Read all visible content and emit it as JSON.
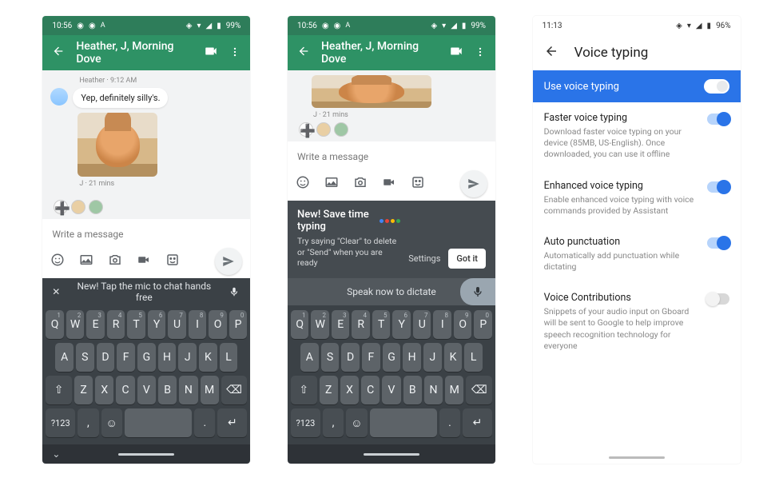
{
  "phones": {
    "p1": {
      "status": {
        "time": "10:56",
        "battery": "99%"
      },
      "title": "Heather, J, Morning Dove",
      "chat": {
        "meta1": "Heather · 9:12 AM",
        "bubble": "Yep, definitely silly's.",
        "meta2": "J · 21 mins"
      },
      "compose_placeholder": "Write a message",
      "strip_text": "New! Tap the mic to chat hands free",
      "kb": {
        "row1": [
          "Q",
          "W",
          "E",
          "R",
          "T",
          "Y",
          "U",
          "I",
          "O",
          "P"
        ],
        "row1sup": [
          "1",
          "2",
          "3",
          "4",
          "5",
          "6",
          "7",
          "8",
          "9",
          "0"
        ],
        "row2": [
          "A",
          "S",
          "D",
          "F",
          "G",
          "H",
          "J",
          "K",
          "L"
        ],
        "row3": [
          "Z",
          "X",
          "C",
          "V",
          "B",
          "N",
          "M"
        ],
        "numkey": "?123",
        "comma": ",",
        "period": "."
      }
    },
    "p2": {
      "status": {
        "time": "10:56",
        "battery": "99%"
      },
      "title": "Heather, J, Morning Dove",
      "chat": {
        "meta2": "J · 21 mins"
      },
      "compose_placeholder": "Write a message",
      "banner": {
        "title": "New! Save time typing",
        "sub": "Try saying \"Clear\" to delete or \"Send\" when you are ready",
        "settings": "Settings",
        "gotit": "Got it"
      },
      "strip_text": "Speak now to dictate"
    },
    "p3": {
      "status": {
        "time": "11:13",
        "battery": "96%"
      },
      "header": "Voice typing",
      "blue": "Use voice typing",
      "items": [
        {
          "t": "Faster voice typing",
          "s": "Download faster voice typing on your device (85MB, US-English). Once downloaded, you can use it offline",
          "on": true
        },
        {
          "t": "Enhanced voice typing",
          "s": "Enable enhanced voice typing with voice commands provided by Assistant",
          "on": true
        },
        {
          "t": "Auto punctuation",
          "s": "Automatically add punctuation while dictating",
          "on": true
        },
        {
          "t": "Voice Contributions",
          "s": "Snippets of your audio input on Gboard will be sent to Google to help improve speech recognition technology for everyone",
          "on": false
        }
      ]
    }
  }
}
